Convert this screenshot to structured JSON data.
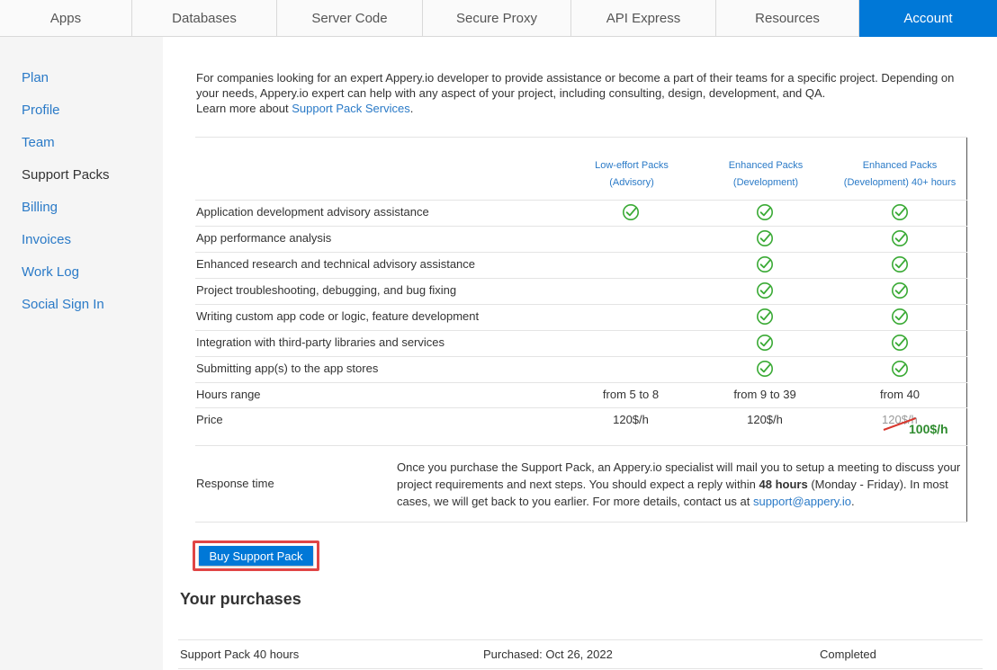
{
  "topnav": {
    "tabs": [
      {
        "label": "Apps"
      },
      {
        "label": "Databases"
      },
      {
        "label": "Server Code"
      },
      {
        "label": "Secure Proxy"
      },
      {
        "label": "API Express"
      },
      {
        "label": "Resources"
      },
      {
        "label": "Account",
        "active": true
      }
    ]
  },
  "sidebar": {
    "items": [
      {
        "label": "Plan"
      },
      {
        "label": "Profile"
      },
      {
        "label": "Team"
      },
      {
        "label": "Support Packs",
        "active": true
      },
      {
        "label": "Billing"
      },
      {
        "label": "Invoices"
      },
      {
        "label": "Work Log"
      },
      {
        "label": "Social Sign In"
      }
    ]
  },
  "intro": {
    "text": "For companies looking for an expert Appery.io developer to provide assistance or become a part of their teams for a specific project. Depending on your needs, Appery.io expert can help with any aspect of your project, including consulting, design, development, and QA.",
    "learn_more_prefix": "Learn more about ",
    "learn_more_link": "Support Pack Services",
    "learn_more_suffix": "."
  },
  "table": {
    "columns": [
      {
        "line1": "Low-effort Packs",
        "line2": "(Advisory)"
      },
      {
        "line1": "Enhanced Packs",
        "line2": "(Development)"
      },
      {
        "line1": "Enhanced Packs",
        "line2": "(Development) 40+ hours"
      }
    ],
    "feature_rows": [
      {
        "label": "Application development advisory assistance",
        "checks": [
          true,
          true,
          true
        ]
      },
      {
        "label": "App performance analysis",
        "checks": [
          false,
          true,
          true
        ]
      },
      {
        "label": "Enhanced research and technical advisory assistance",
        "checks": [
          false,
          true,
          true
        ]
      },
      {
        "label": "Project troubleshooting, debugging, and bug fixing",
        "checks": [
          false,
          true,
          true
        ]
      },
      {
        "label": "Writing custom app code or logic, feature development",
        "checks": [
          false,
          true,
          true
        ]
      },
      {
        "label": "Integration with third-party libraries and services",
        "checks": [
          false,
          true,
          true
        ]
      },
      {
        "label": "Submitting app(s) to the app stores",
        "checks": [
          false,
          true,
          true
        ]
      }
    ],
    "hours_row": {
      "label": "Hours range",
      "values": [
        "from 5 to 8",
        "from 9 to 39",
        "from 40"
      ]
    },
    "price_row": {
      "label": "Price",
      "values": [
        "120$/h",
        "120$/h"
      ],
      "old_price": "120$/h",
      "new_price": "100$/h"
    },
    "response_row": {
      "label": "Response time",
      "text_before": "Once you purchase the Support Pack, an Appery.io specialist will mail you to setup a meeting to discuss your project requirements and next steps. You should expect a reply within ",
      "bold": "48 hours",
      "text_after": " (Monday - Friday). In most cases, we will get back to you earlier. For more details, contact us at ",
      "email": "support@appery.io",
      "end": "."
    },
    "check_color": "#3aaa35"
  },
  "buy_button": {
    "label": "Buy Support Pack"
  },
  "purchases": {
    "title": "Your purchases",
    "rows": [
      {
        "name": "Support Pack 40 hours",
        "purchased": "Purchased: Oct 26, 2022",
        "status": "Completed"
      }
    ]
  }
}
